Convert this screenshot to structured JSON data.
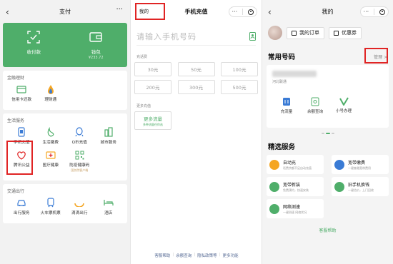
{
  "pay_panel": {
    "title": "支付",
    "capsule": {
      "more": "···"
    },
    "wallet": {
      "receive_label": "收付款",
      "wallet_label": "钱包",
      "wallet_amount": "¥233.72"
    },
    "finance": {
      "title": "金融理财",
      "items": [
        "信用卡还款",
        "理财通"
      ]
    },
    "life": {
      "title": "生活服务",
      "items": [
        "手机充值",
        "生活缴费",
        "Q币充值",
        "城市服务",
        "腾讯公益",
        "医疗健康",
        "防疫健康码"
      ],
      "badge": "国务院客户端"
    },
    "transport": {
      "title": "交通出行",
      "items": [
        "出行服务",
        "火车票机票",
        "滴滴出行",
        "酒店"
      ]
    }
  },
  "topup_panel": {
    "mine_tab": "我的",
    "title": "手机充值",
    "capsule": {
      "more": "···"
    },
    "phone_placeholder": "请输入手机号码",
    "topup_section": "充话费",
    "amounts": [
      "30元",
      "50元",
      "100元",
      "200元",
      "300元",
      "500元"
    ],
    "data_section": "更多充值",
    "more_data": {
      "title": "更多流量",
      "subtitle": "多种流量任你选"
    },
    "footer": [
      "客服帮助",
      "余额查询",
      "隐私政策等",
      "更多功能"
    ]
  },
  "mine_panel": {
    "title": "我的",
    "capsule": {
      "more": "···"
    },
    "orders_label": "我的订单",
    "coupons_label": "优惠券",
    "common_numbers_title": "常用号码",
    "manage_label": "管理 >",
    "carrier": "河北联通",
    "number_actions": [
      "充流量",
      "余额查询",
      "小号办理"
    ],
    "featured_title": "精选服务",
    "services": [
      {
        "title": "自动充",
        "subtitle": "话费余额不足自动充值",
        "color": "#f5a623"
      },
      {
        "title": "宽带缴费",
        "subtitle": "一键查缴宽带费用",
        "color": "#3a7bd5"
      },
      {
        "title": "宽带新装",
        "subtitle": "免费预约，快速安装",
        "color": "#4fae6a"
      },
      {
        "title": "旧手机换钱",
        "subtitle": "一键估价，上门回收",
        "color": "#4fae6a"
      },
      {
        "title": "网络测速",
        "subtitle": "一键测速 网络状况",
        "color": "#4fae6a"
      }
    ],
    "help_label": "客服帮助"
  }
}
